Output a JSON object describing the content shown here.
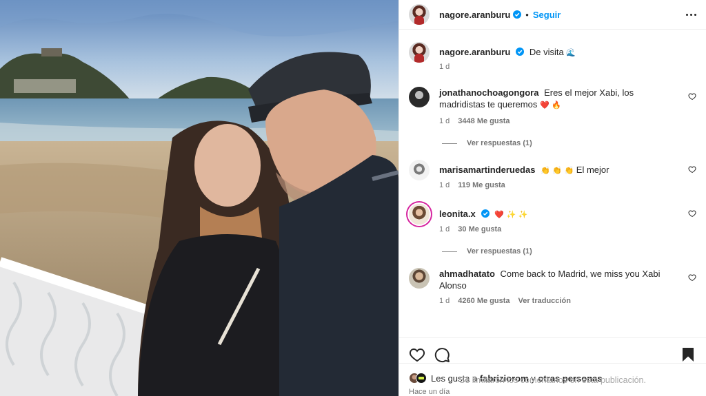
{
  "header": {
    "username": "nagore.aranburu",
    "separator": "•",
    "follow_label": "Seguir"
  },
  "caption": {
    "username": "nagore.aranburu",
    "text": "De visita",
    "emoji": "🌊",
    "time": "1 d"
  },
  "comments": [
    {
      "username": "jonathanochoagongora",
      "text": "Eres el mejor Xabi, los madridistas te queremos",
      "emoji": "❤️ 🔥",
      "time": "1 d",
      "likes": "3448 Me gusta",
      "replies": "Ver respuestas (1)"
    },
    {
      "username": "marisamartinderuedas",
      "emoji": "👏 👏 👏",
      "text": "El mejor",
      "time": "1 d",
      "likes": "119 Me gusta"
    },
    {
      "username": "leonita.x",
      "emoji": "❤️ ✨ ✨",
      "time": "1 d",
      "likes": "30 Me gusta",
      "replies": "Ver respuestas (1)"
    },
    {
      "username": "ahmadhatato",
      "text": "Come back to Madrid, we miss you Xabi Alonso",
      "time": "1 d",
      "likes": "4260 Me gusta",
      "translate": "Ver traducción"
    }
  ],
  "likes_summary": {
    "prefix": "Les gusta a",
    "user": "fabriziorom",
    "joiner": "y",
    "others": "otras personas"
  },
  "posted": "Hace un día",
  "comments_limited": "Se limitaron los comentarios en esta publicación.",
  "icons": [
    "verified-badge-icon",
    "more-options-icon",
    "heart-icon",
    "comment-icon",
    "bookmark-icon"
  ],
  "colors": {
    "link": "#0095f6",
    "muted": "#737373",
    "text": "#262626",
    "border": "#efefef"
  }
}
